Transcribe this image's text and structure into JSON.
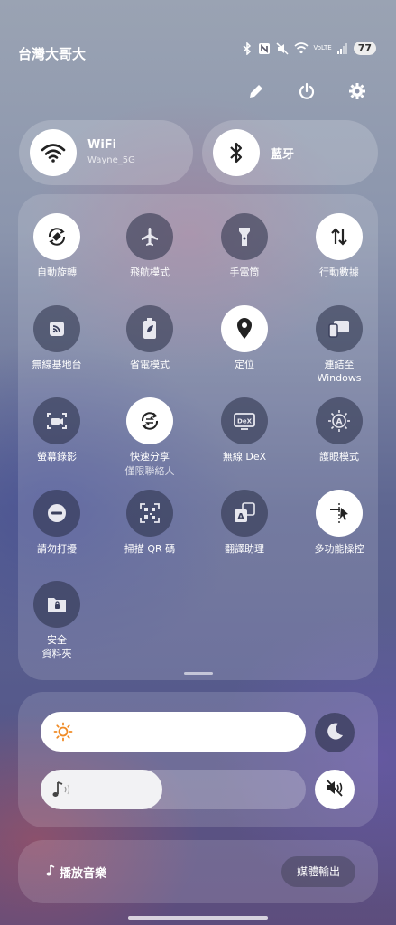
{
  "status_bar": {
    "carrier": "台灣大哥大",
    "network_label": "VoLTE",
    "battery": "77",
    "icons": [
      "bluetooth-icon",
      "nfc-icon",
      "mute-icon",
      "wifi-icon",
      "volte-icon",
      "signal-icon",
      "battery-icon"
    ]
  },
  "header_actions": [
    {
      "name": "edit-icon"
    },
    {
      "name": "power-icon"
    },
    {
      "name": "settings-icon"
    }
  ],
  "connections": {
    "wifi": {
      "title": "WiFi",
      "subtitle": "Wayne_5G",
      "active": true
    },
    "bluetooth": {
      "title": "藍牙",
      "active": false
    }
  },
  "tiles": [
    {
      "label": "自動旋轉",
      "active": true,
      "icon": "auto-rotate-icon"
    },
    {
      "label": "飛航模式",
      "active": false,
      "icon": "airplane-icon"
    },
    {
      "label": "手電筒",
      "active": false,
      "icon": "flashlight-icon"
    },
    {
      "label": "行動數據",
      "active": true,
      "icon": "mobile-data-icon"
    },
    {
      "label": "無線基地台",
      "active": false,
      "icon": "hotspot-icon"
    },
    {
      "label": "省電模式",
      "active": false,
      "icon": "battery-saver-icon"
    },
    {
      "label": "定位",
      "active": true,
      "icon": "location-icon"
    },
    {
      "label": "連結至",
      "label2": "Windows",
      "active": false,
      "icon": "link-windows-icon"
    },
    {
      "label": "螢幕錄影",
      "active": false,
      "icon": "screen-record-icon"
    },
    {
      "label": "快速分享",
      "sublabel": "僅限聯絡人",
      "active": true,
      "icon": "quick-share-icon"
    },
    {
      "label": "無線 DeX",
      "active": false,
      "icon": "dex-icon"
    },
    {
      "label": "護眼模式",
      "active": false,
      "icon": "eye-comfort-icon"
    },
    {
      "label": "請勿打擾",
      "active": false,
      "icon": "do-not-disturb-icon"
    },
    {
      "label": "掃描 QR 碼",
      "active": false,
      "icon": "qr-scan-icon"
    },
    {
      "label": "翻譯助理",
      "active": false,
      "icon": "translate-icon"
    },
    {
      "label": "多功能操控",
      "active": true,
      "icon": "multi-control-icon"
    },
    {
      "label": "安全",
      "label2": "資料夾",
      "active": false,
      "icon": "secure-folder-icon"
    }
  ],
  "sliders": {
    "brightness": {
      "level": 1.0,
      "icon": "sun-icon"
    },
    "volume": {
      "level": 0.46,
      "icon": "music-note-icon"
    }
  },
  "media": {
    "label": "播放音樂",
    "output_label": "媒體輸出"
  },
  "colors": {
    "active_tile": "#ffffff",
    "inactive_tile": "#2d3250",
    "accent_sun": "#f08a24"
  }
}
